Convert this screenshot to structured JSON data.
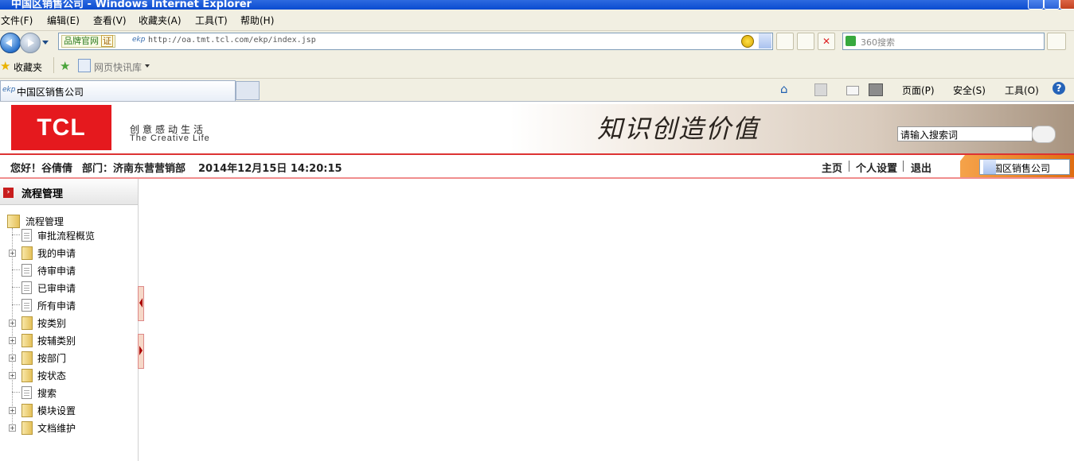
{
  "window": {
    "title": "中国区销售公司 - Windows Internet Explorer"
  },
  "menubar": {
    "items": [
      "文件(F)",
      "编辑(E)",
      "查看(V)",
      "收藏夹(A)",
      "工具(T)",
      "帮助(H)"
    ]
  },
  "addressbar": {
    "brand_tag": "品牌官网",
    "cert_tag": "证",
    "url": "http://oa.tmt.tcl.com/ekp/index.jsp",
    "search_placeholder": "360搜索"
  },
  "favbar": {
    "favorites_label": "收藏夹",
    "webslice_label": "网页快讯库"
  },
  "tabbar": {
    "active_tab": "中国区销售公司",
    "commands": {
      "page": "页面(P)",
      "safety": "安全(S)",
      "tools": "工具(O)"
    }
  },
  "banner": {
    "logo_text": "TCL",
    "slogan_cn": "创意感动生活",
    "slogan_en": "The Creative Life",
    "calligraphy": "知识创造价值",
    "search_placeholder": "请输入搜索词"
  },
  "infobar": {
    "greeting": "您好！谷倩倩",
    "department": "部门：济南东营营销部",
    "datetime": "2014年12月15日  14:20:15",
    "links": [
      "主页",
      "个人设置",
      "退出"
    ],
    "area_selected": "中国区销售公司"
  },
  "sidebar": {
    "title": "流程管理",
    "root": "流程管理",
    "items": [
      {
        "label": "审批流程概览",
        "type": "doc",
        "expandable": false
      },
      {
        "label": "我的申请",
        "type": "folder",
        "expandable": true
      },
      {
        "label": "待审申请",
        "type": "doc",
        "expandable": false
      },
      {
        "label": "已审申请",
        "type": "doc",
        "expandable": false
      },
      {
        "label": "所有申请",
        "type": "doc",
        "expandable": false
      },
      {
        "label": "按类别",
        "type": "folder",
        "expandable": true
      },
      {
        "label": "按辅类别",
        "type": "folder",
        "expandable": true
      },
      {
        "label": "按部门",
        "type": "folder",
        "expandable": true
      },
      {
        "label": "按状态",
        "type": "folder",
        "expandable": true
      },
      {
        "label": "搜索",
        "type": "doc",
        "expandable": false
      },
      {
        "label": "模块设置",
        "type": "folder",
        "expandable": true
      },
      {
        "label": "文档维护",
        "type": "folder",
        "expandable": true
      }
    ]
  },
  "colors": {
    "brand_red": "#e5191e",
    "accent_orange": "#e06d12",
    "ie_chrome": "#f1efe2"
  }
}
